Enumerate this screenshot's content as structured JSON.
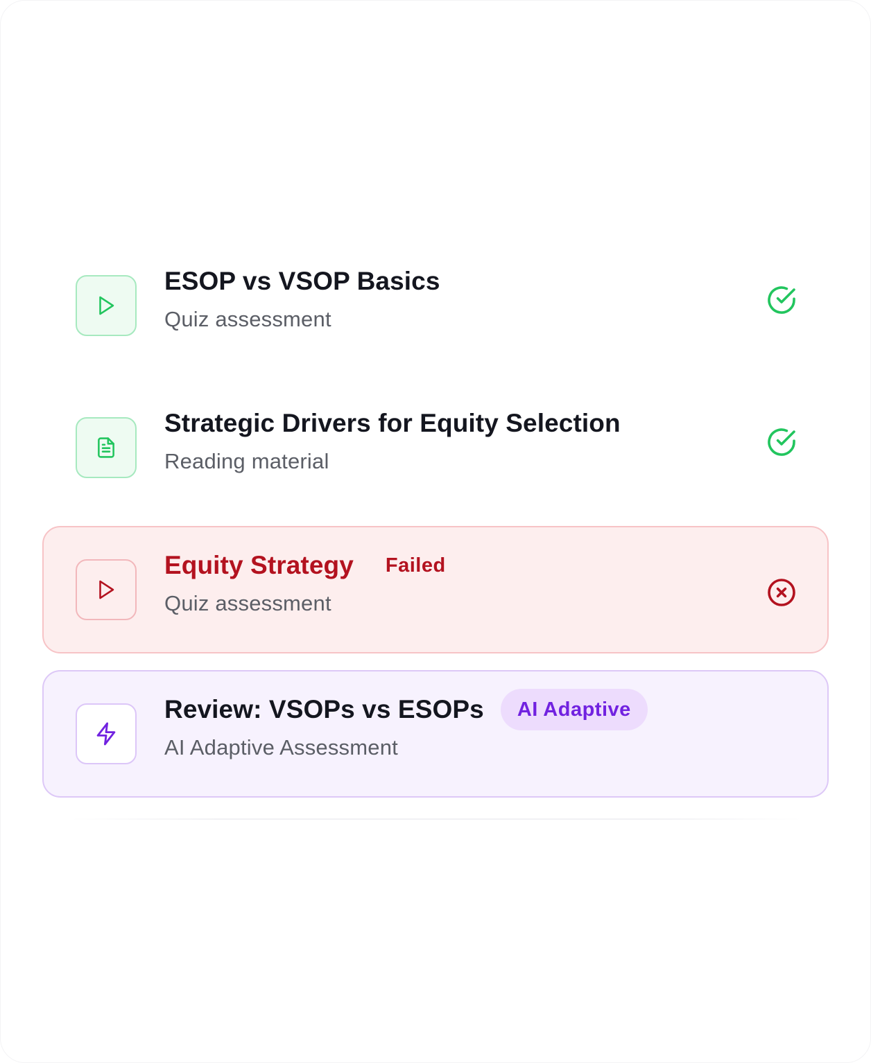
{
  "lessons": [
    {
      "title": "ESOP vs VSOP Basics",
      "subtitle": "Quiz assessment",
      "icon": "play-icon",
      "status": "completed",
      "status_icon": "check-circle-icon"
    },
    {
      "title": "Strategic Drivers for Equity Selection",
      "subtitle": "Reading material",
      "icon": "document-icon",
      "status": "completed",
      "status_icon": "check-circle-icon"
    },
    {
      "title": "Equity Strategy",
      "badge": "Failed",
      "subtitle": "Quiz assessment",
      "icon": "play-icon",
      "status": "failed",
      "status_icon": "x-circle-icon"
    },
    {
      "title": "Review: VSOPs vs ESOPs",
      "badge": "AI Adaptive",
      "subtitle": "AI Adaptive Assessment",
      "icon": "lightning-icon",
      "status": "ai-adaptive"
    }
  ],
  "colors": {
    "success": "#22c55e",
    "error": "#b3121f",
    "ai_accent": "#7122e0",
    "title_text": "#14161f",
    "subtitle_text": "#5b5e66"
  }
}
